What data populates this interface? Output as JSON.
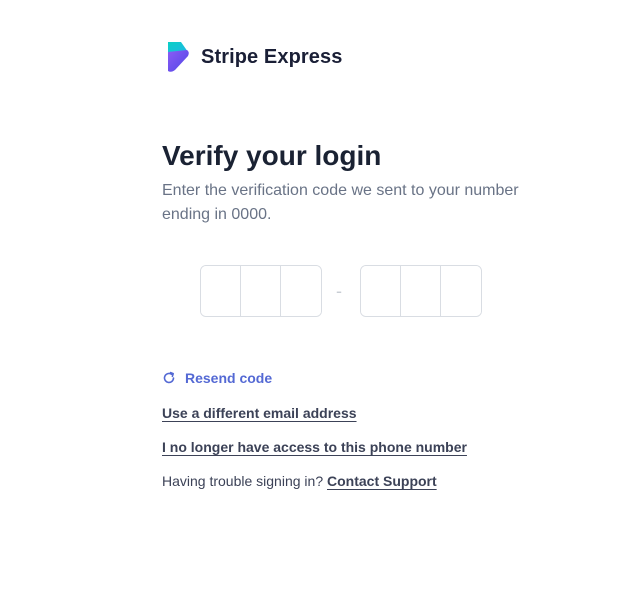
{
  "header": {
    "logo_icon": "stripe-express-logo-icon",
    "brand_name": "Stripe Express",
    "logo_colors": [
      "#0ad0c4",
      "#7a5af8",
      "#4f46e5"
    ]
  },
  "main": {
    "title": "Verify your login",
    "subtitle": "Enter the verification code we sent to your number ending in 0000.",
    "code": {
      "group1": [
        "",
        "",
        ""
      ],
      "group2": [
        "",
        "",
        ""
      ],
      "separator": "-"
    },
    "resend": {
      "icon": "refresh-icon",
      "label": "Resend code"
    },
    "links": {
      "different_email": "Use a different email address",
      "no_phone_access": "I no longer have access to this phone number"
    },
    "trouble": {
      "text": "Having trouble signing in?",
      "support_label": "Contact Support"
    }
  },
  "colors": {
    "accent": "#5469d4",
    "title": "#1a2233",
    "muted": "#697386",
    "border": "#d9dde3"
  }
}
